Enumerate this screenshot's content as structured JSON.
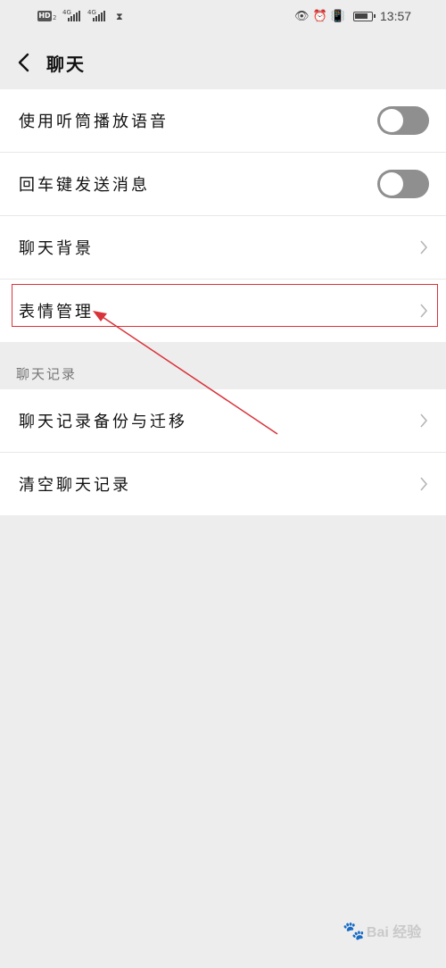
{
  "status_bar": {
    "hd": "HD",
    "hd_sub": "2",
    "network1": "4G",
    "network2": "4G",
    "time": "13:57",
    "battery_level": 0.85
  },
  "header": {
    "title": "聊天"
  },
  "settings": {
    "items": [
      {
        "label": "使用听筒播放语音",
        "type": "toggle",
        "on": false
      },
      {
        "label": "回车键发送消息",
        "type": "toggle",
        "on": false
      },
      {
        "label": "聊天背景",
        "type": "link"
      },
      {
        "label": "表情管理",
        "type": "link"
      }
    ]
  },
  "history": {
    "section_title": "聊天记录",
    "items": [
      {
        "label": "聊天记录备份与迁移",
        "type": "link"
      },
      {
        "label": "清空聊天记录",
        "type": "link"
      }
    ]
  },
  "watermark": "Bai 经验",
  "colors": {
    "background": "#ededed",
    "highlight": "#d9333a",
    "toggle_off": "#8f8f8f"
  }
}
